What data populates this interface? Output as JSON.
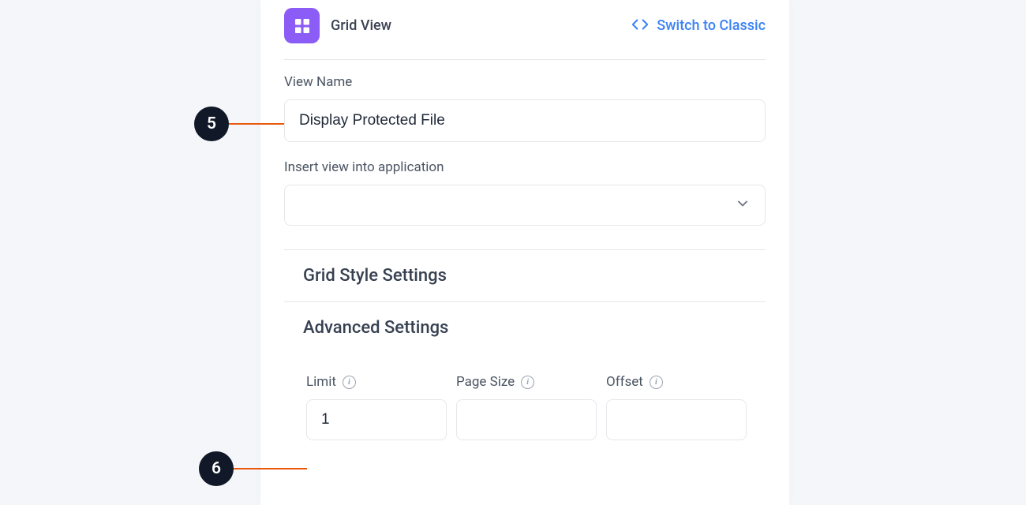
{
  "header": {
    "title": "Grid View",
    "switch_label": "Switch to Classic"
  },
  "view_name": {
    "label": "View Name",
    "value": "Display Protected File"
  },
  "insert_view": {
    "label": "Insert view into application",
    "value": ""
  },
  "sections": {
    "grid_style": "Grid Style Settings",
    "advanced": "Advanced Settings"
  },
  "advanced_fields": {
    "limit": {
      "label": "Limit",
      "value": "1"
    },
    "page_size": {
      "label": "Page Size",
      "value": ""
    },
    "offset": {
      "label": "Offset",
      "value": ""
    }
  },
  "annotations": {
    "badge5": "5",
    "badge6": "6"
  }
}
